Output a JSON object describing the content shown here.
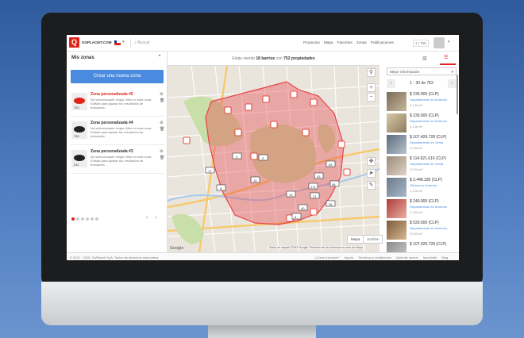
{
  "brand": {
    "logo_letter": "Q",
    "name": "GOPLACEIT.COM"
  },
  "topbar": {
    "search_placeholder": "Buscar",
    "nav": [
      "Proyectos",
      "Mapa",
      "Favoritos",
      "Zonas",
      "Publicaciones"
    ],
    "counter": "1 | 755",
    "icons": {
      "country_flag": "chile-flag-icon",
      "user": "user-avatar-icon",
      "dropdown": "chevron-down-icon"
    }
  },
  "sidebar": {
    "title": "Mis zonas",
    "create_button": "Crear una nueva zona",
    "zones": [
      {
        "name": "Zona personalizada #5",
        "description": "No seleccionaste ningún filtro en esta zona. Edítala para ajustar tus resultados de búsqueda.",
        "count": "752",
        "active": true,
        "color": "#e2231a"
      },
      {
        "name": "Zona personalizada #4",
        "description": "No seleccionaste ningún filtro en esta zona. Edítala para ajustar tus resultados de búsqueda.",
        "count": "752",
        "active": false,
        "color": "#222222"
      },
      {
        "name": "Zona personalizada #3",
        "description": "No seleccionaste ningún filtro en esta zona. Edítala para ajustar tus resultados de búsqueda.",
        "count": "311",
        "active": false,
        "color": "#222222"
      }
    ],
    "pager_dots": 6,
    "active_dot": 0
  },
  "map_header": {
    "prefix": "Estás viendo",
    "barrios": "18 barrios",
    "mid": "con",
    "props": "752 propiedades"
  },
  "map": {
    "markers": [
      "2",
      "3",
      "8",
      "15",
      "17",
      "19",
      "21",
      "36",
      "40",
      "43",
      "58",
      "83",
      "171",
      "8",
      "9",
      "7",
      "33",
      "10"
    ],
    "type_buttons": [
      "Mapa",
      "Satélite"
    ],
    "google": "Google",
    "attribution": "Datos de mapas ©2015 Google   Términos de uso   Informar un error de Mapa",
    "area_color": "#e8434a"
  },
  "listings_panel": {
    "sort_label": "Mejor información",
    "range": "1 - 30 de 752",
    "listings": [
      {
        "price": "$ 235.000 (CLP)",
        "type": "Departamento en Arriendo",
        "meta": "2  1  46 m²"
      },
      {
        "price": "$ 230.000 (CLP)",
        "type": "Departamento en Arriendo",
        "meta": "1  1  30 m²"
      },
      {
        "price": "$ 107.426.728 (CLP)",
        "type": "Departamento en Venta",
        "meta": "2  2  54 m²"
      },
      {
        "price": "$ 114.921.616 (CLP)",
        "type": "Departamento en Venta",
        "meta": "2  2  54 m²"
      },
      {
        "price": "$ 2.448.330 (CLP)",
        "type": "Oficina en Arriendo",
        "meta": "1  1  34 m²"
      },
      {
        "price": "$ 240.000 (CLP)",
        "type": "Departamento en Arriendo",
        "meta": "2  1  52 m²"
      },
      {
        "price": "$ 520.000 (CLP)",
        "type": "Departamento en Arriendo",
        "meta": "2  2  54 m²"
      },
      {
        "price": "$ 107.426.728 (CLP)",
        "type": "Departamento en Venta",
        "meta": ""
      }
    ]
  },
  "footer": {
    "copyright": "© 2012 - 2015, GoPlaceIt SpA. Todos los derechos reservados.",
    "links": [
      "¿Cómo funciona?",
      "Ayuda",
      "Términos y condiciones",
      "Quiénes somos",
      "Inscríbete",
      "Blog"
    ]
  }
}
